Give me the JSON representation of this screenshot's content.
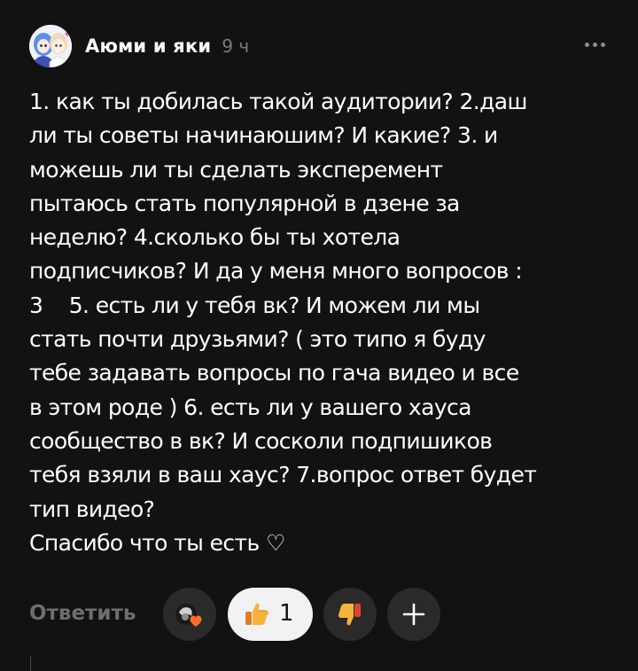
{
  "comment": {
    "author": "Аюми и яки",
    "time": "9 ч",
    "text": "1. как ты добилась такой аудитории? 2.даш\nли ты советы начинаюшим? И какие? 3. и\nможешь ли ты сделать эксперемент\nпытаюсь стать популярной в дзене за\nнеделю? 4.сколько бы ты хотела\nподписчиков? И да у меня много вопросов :\n3    5. есть ли у тебя вк? И можем ли мы\nстать почти друзьями? ( это типо я буду\nтебе задавать вопросы по гача видео и все\nв этом роде ) 6. есть ли у вашего хауса\nсообщество в вк? И сосколи подпишиков\nтебя взяли в ваш хаус? 7.вопрос ответ будет\nтип видео?\nСпасибо что ты есть ♡"
  },
  "actions": {
    "reply_label": "Ответить",
    "like_count": "1",
    "icons": {
      "reactors": "reactor-avatars-icon",
      "like": "thumbs-up-icon",
      "dislike": "thumbs-down-icon",
      "add": "plus-icon",
      "more": "more-dots-icon"
    }
  },
  "colors": {
    "background": "#121212",
    "text": "#ffffff",
    "muted": "#6e6e6e",
    "pill_active": "#f2f2f2",
    "pill_inactive": "#2a2a2a"
  }
}
